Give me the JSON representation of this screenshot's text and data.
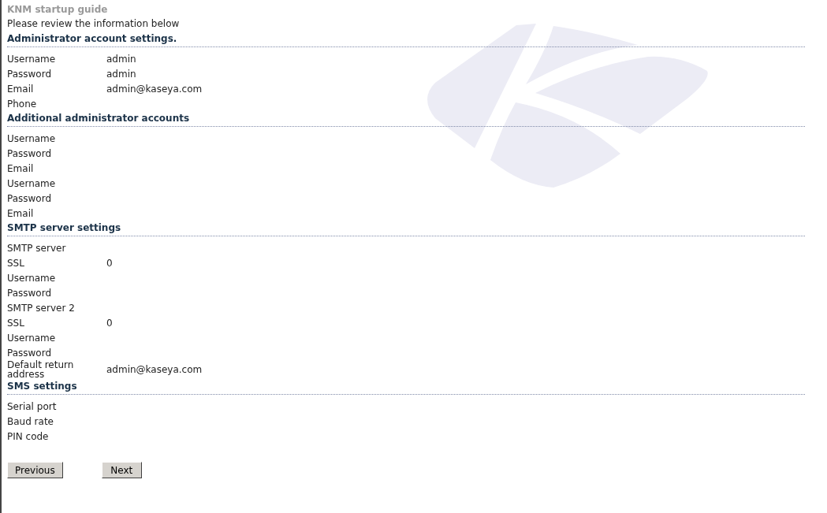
{
  "title": "KNM startup guide",
  "intro": "Please review the information below",
  "sections": [
    {
      "heading": "Administrator account settings.",
      "rows": [
        {
          "label": "Username",
          "value": "admin"
        },
        {
          "label": "Password",
          "value": "admin"
        },
        {
          "label": "Email",
          "value": "admin@kaseya.com"
        },
        {
          "label": "Phone"
        }
      ]
    },
    {
      "heading": "Additional administrator accounts",
      "rows": [
        {
          "label": "Username"
        },
        {
          "label": "Password"
        },
        {
          "label": "Email"
        },
        {
          "label": "Username"
        },
        {
          "label": "Password"
        },
        {
          "label": "Email"
        }
      ]
    },
    {
      "heading": "SMTP server settings",
      "rows": [
        {
          "label": "SMTP server"
        },
        {
          "label": "SSL",
          "value": "0"
        },
        {
          "label": "Username"
        },
        {
          "label": "Password"
        },
        {
          "label": "SMTP server 2"
        },
        {
          "label": "SSL",
          "value": "0"
        },
        {
          "label": "Username"
        },
        {
          "label": "Password"
        },
        {
          "label": "Default return address",
          "value": "admin@kaseya.com"
        }
      ]
    },
    {
      "heading": "SMS settings",
      "rows": [
        {
          "label": "Serial port"
        },
        {
          "label": "Baud rate"
        },
        {
          "label": "PIN code"
        }
      ]
    }
  ],
  "buttons": [
    {
      "label": "Previous"
    },
    {
      "label": "Next"
    }
  ]
}
